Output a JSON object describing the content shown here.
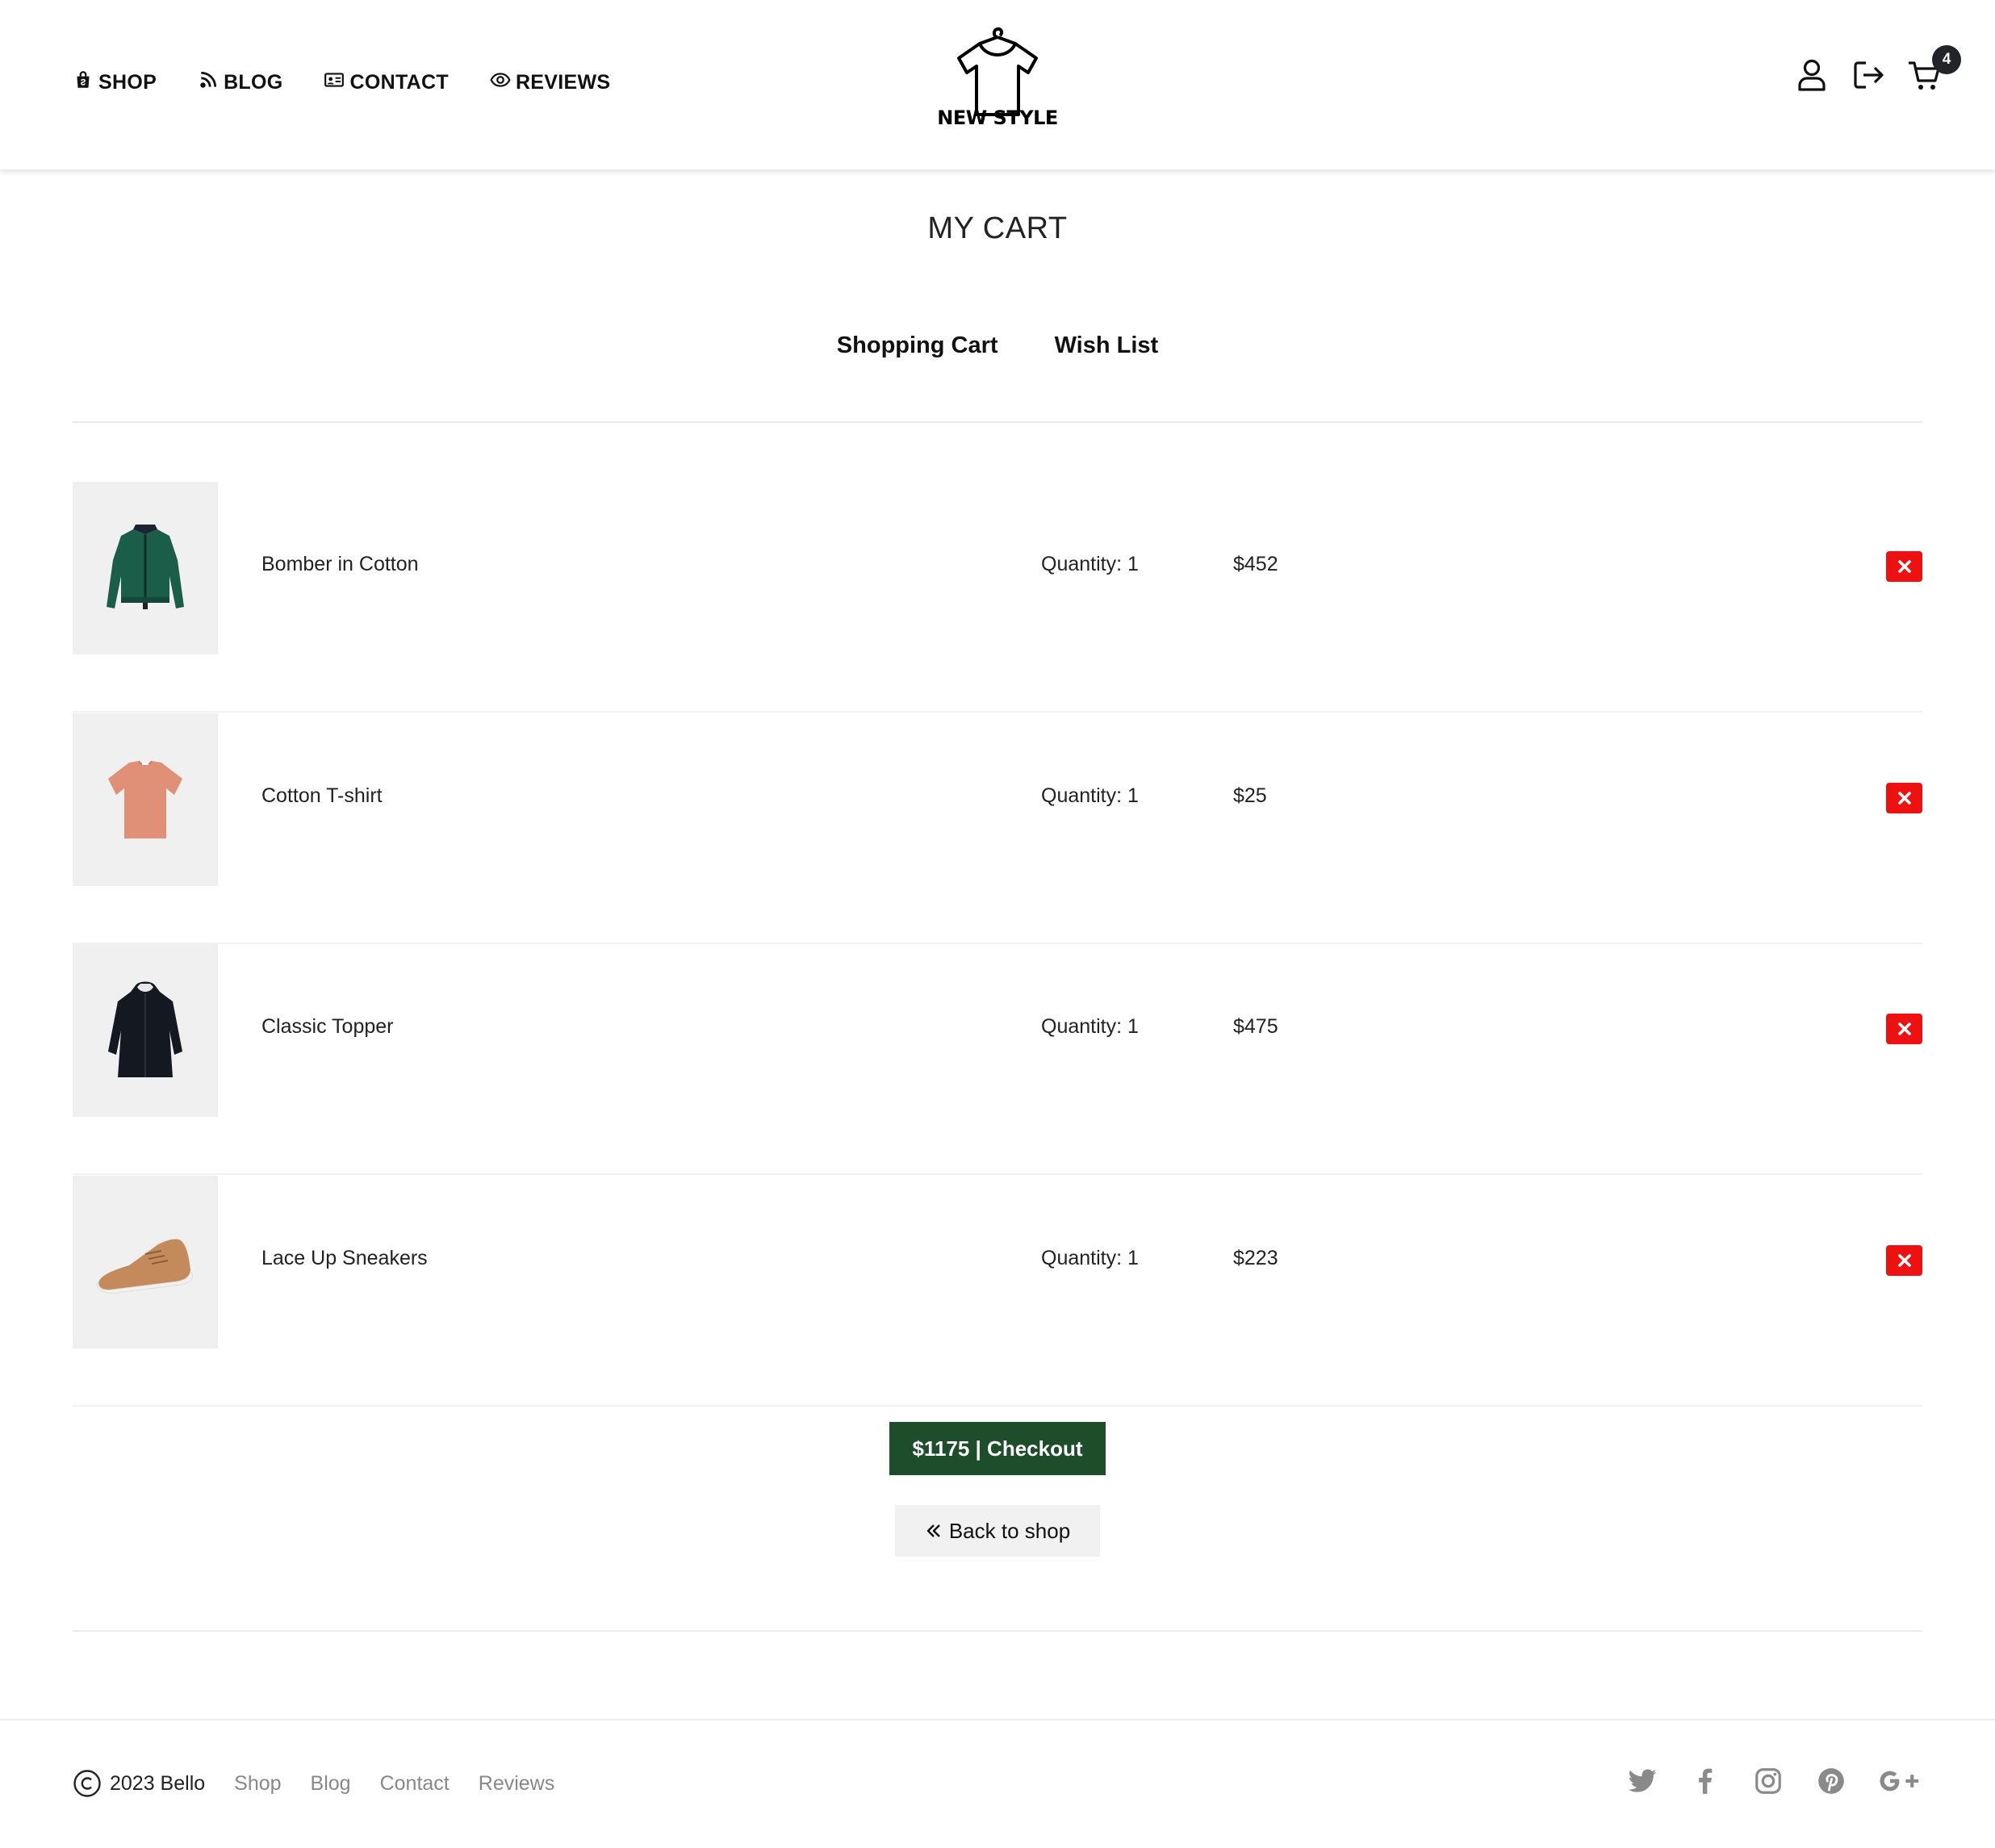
{
  "header": {
    "nav": [
      {
        "label": "SHOP",
        "icon": "shopping-bag-icon"
      },
      {
        "label": "BLOG",
        "icon": "rss-icon"
      },
      {
        "label": "CONTACT",
        "icon": "contact-card-icon"
      },
      {
        "label": "REVIEWS",
        "icon": "eye-icon"
      }
    ],
    "logo_text": "NEW STYLE",
    "cart_count": "4"
  },
  "page": {
    "title": "MY CART",
    "tabs": [
      "Shopping Cart",
      "Wish List"
    ]
  },
  "cart": {
    "items": [
      {
        "name": "Bomber in Cotton",
        "quantity": "Quantity: 1",
        "price": "$452",
        "image": "green-bomber-jacket"
      },
      {
        "name": "Cotton T-shirt",
        "quantity": "Quantity: 1",
        "price": "$25",
        "image": "salmon-t-shirt"
      },
      {
        "name": "Classic Topper",
        "quantity": "Quantity: 1",
        "price": "$475",
        "image": "black-coat"
      },
      {
        "name": "Lace Up Sneakers",
        "quantity": "Quantity: 1",
        "price": "$223",
        "image": "tan-sneaker"
      }
    ],
    "checkout_label": "$1175 | Checkout",
    "back_label": "Back to shop"
  },
  "footer": {
    "copyright": "2023 Bello",
    "links": [
      "Shop",
      "Blog",
      "Contact",
      "Reviews"
    ],
    "social": [
      "twitter-icon",
      "facebook-icon",
      "instagram-icon",
      "pinterest-icon",
      "google-plus-icon"
    ]
  },
  "colors": {
    "checkout": "#1e4d2b",
    "remove": "#ee1111",
    "badge": "#23242a",
    "thumb_bg": "#f0f0f0"
  }
}
